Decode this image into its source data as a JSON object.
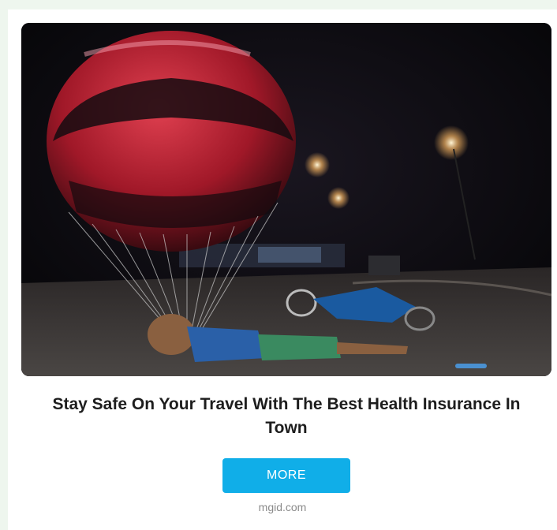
{
  "ad": {
    "headline": "Stay Safe On Your Travel With The Best Health Insurance In Town",
    "button_label": "MORE",
    "source": "mgid.com"
  },
  "colors": {
    "page_background": "#eef6ee",
    "button": "#10aee8",
    "headline_text": "#1d1d1d",
    "source_text": "#8a8a8a"
  }
}
